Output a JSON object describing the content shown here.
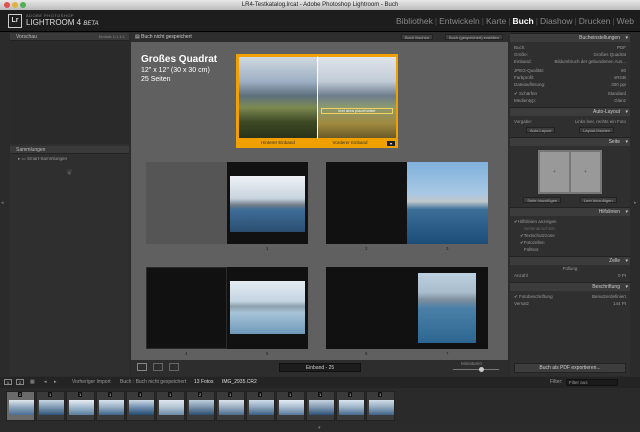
{
  "window": {
    "title": "LR4-Testkatalog.lrcat - Adobe Photoshop Lightroom - Buch"
  },
  "identity": {
    "logo": "Lr",
    "brand_top": "ADOBE PHOTOSHOP",
    "brand_main": "LIGHTROOM 4",
    "brand_beta": "BETA"
  },
  "modules": [
    {
      "label": "Bibliothek"
    },
    {
      "label": "Entwickeln"
    },
    {
      "label": "Karte"
    },
    {
      "label": "Buch",
      "active": true
    },
    {
      "label": "Diashow"
    },
    {
      "label": "Drucken"
    },
    {
      "label": "Web"
    }
  ],
  "left": {
    "preview_title": "Vorschau",
    "preview_meta": "Einfalls 1:1 4:1",
    "collections_title": "Sammlungen",
    "collections_item": "Smart-Sammlungen"
  },
  "center": {
    "status": "Buch nicht gespeichert",
    "btn_clear": "Buch löschen",
    "btn_create": "Buch (gespeichert) erstellen",
    "book_title": "Großes Quadrat",
    "book_size": "12\" x 12\" (30 x 30 cm)",
    "book_pages": "25 Seiten",
    "back_cover": "Hinterer Einband",
    "front_cover": "Vorderer Einband",
    "cover_text": "text area placeholder",
    "page_labels": [
      "1",
      "2",
      "3",
      "4",
      "5",
      "6",
      "7"
    ],
    "pager": "Einband - 25",
    "thumb_label": "Miniaturen"
  },
  "right": {
    "settings_title": "Bucheinstellungen",
    "book_label": "Buch:",
    "book_value": "PDF",
    "size_label": "Größe:",
    "size_value": "Großes Quadrat",
    "cover_label": "Einband:",
    "cover_value": "Bildumbruch der gebundenen Aus...",
    "jpeg_label": "JPEG-Qualität:",
    "jpeg_value": "80",
    "color_label": "Farbprofil:",
    "color_value": "sRGB",
    "res_label": "Dateiauflösung:",
    "res_value": "300 ppi",
    "sharpen_label": "Schärfen",
    "sharpen_value": "Standard",
    "media_label": "Medientyp:",
    "media_value": "Glanz",
    "autolayout_title": "Auto-Layout",
    "presets_label": "Vorgabe:",
    "presets_value": "Links leer, rechts ein Foto",
    "btn_autolayout": "Auto-Layout",
    "btn_clear_layout": "Layout löschen",
    "page_title": "Seite",
    "btn_pagenum": "Seite hinzufügen",
    "btn_blank": "Leer hinzufügen",
    "guides_title": "Hilfslinien",
    "guides_show": "Hilfslinien anzeigen",
    "guides": [
      "Seitenanschnitt",
      "Textschutzzone",
      "Fotozellen",
      "Fülltext"
    ],
    "cell_title": "Zelle",
    "padding_label": "Füllung",
    "amount_label": "Anzahl",
    "amount_value": "0 Pt",
    "caption_title": "Beschriftung",
    "caption_photo": "Fotobeschriftung",
    "caption_photo_value": "Benutzerdefiniert",
    "offset_label": "Versatz",
    "offset_value": "144 Pt",
    "export_btn": "Buch als PDF exportieren..."
  },
  "filmstrip": {
    "nav_prev": "Vorheriger Import",
    "path": "Buch : Buch nicht gespeichert",
    "count": "13 Fotos",
    "selected": "/ ausgewählt",
    "file": "IMG_2935.CR2",
    "filter_label": "Filter:",
    "filter_value": "Filter aus",
    "badges": [
      "2",
      "1",
      "1",
      "1",
      "1",
      "1",
      "2",
      "1",
      "1",
      "1",
      "1",
      "1",
      "1"
    ]
  },
  "colors": {
    "accent": "#f0a000",
    "bg": "#606060",
    "panel": "#2f2f2f"
  }
}
